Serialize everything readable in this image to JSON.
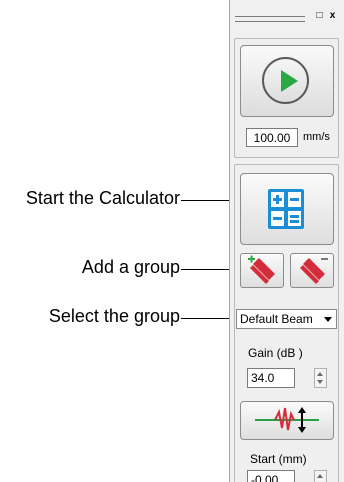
{
  "callouts": {
    "calculator": "Start the Calculator",
    "add_group": "Add a group",
    "select_group": "Select the group"
  },
  "panel": {
    "titlebar": {
      "restore_glyph": "□",
      "close_glyph": "x"
    },
    "scan_speed": {
      "value": "100.00",
      "unit": "mm/s"
    },
    "group_selector": {
      "selected": "Default Beam"
    },
    "gain": {
      "label": "Gain (dB )",
      "value": "34.0"
    },
    "start": {
      "label": "Start  (mm)",
      "value": "-0.00"
    }
  },
  "icons": {
    "play": "play-icon",
    "calculator": "calculator-icon",
    "add_group": "add-group-icon",
    "delete_group": "delete-group-icon",
    "ascan": "ascan-icon"
  },
  "colors": {
    "play_green": "#2aa843",
    "calc_blue": "#1a8fd6",
    "group_red": "#d42c3a",
    "ascan_green": "#29a047"
  }
}
